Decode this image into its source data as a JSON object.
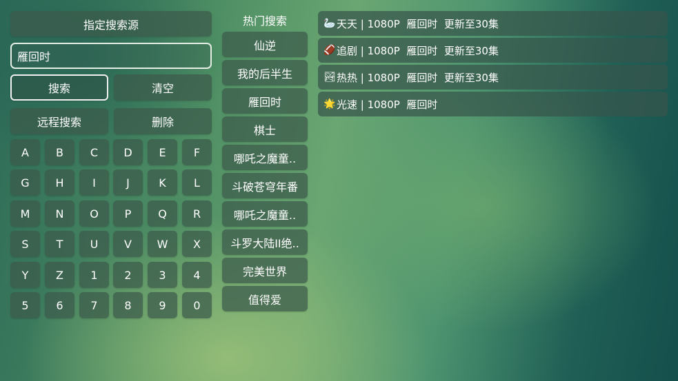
{
  "left_panel": {
    "source_button": "指定搜索源",
    "search_input": {
      "value": "雁回时",
      "placeholder": ""
    },
    "search_button": "搜索",
    "clear_button": "清空",
    "remote_search_button": "远程搜索",
    "delete_button": "删除",
    "keyboard": [
      "A",
      "B",
      "C",
      "D",
      "E",
      "F",
      "G",
      "H",
      "I",
      "J",
      "K",
      "L",
      "M",
      "N",
      "O",
      "P",
      "Q",
      "R",
      "S",
      "T",
      "U",
      "V",
      "W",
      "X",
      "Y",
      "Z",
      "1",
      "2",
      "3",
      "4",
      "5",
      "6",
      "7",
      "8",
      "9",
      "0"
    ]
  },
  "hot_search": {
    "title": "热门搜索",
    "items": [
      "仙逆",
      "我的后半生",
      "雁回时",
      "棋士",
      "哪吒之魔童..",
      "斗破苍穹年番",
      "哪吒之魔童..",
      "斗罗大陆II绝..",
      "完美世界",
      "值得爱"
    ]
  },
  "results": [
    {
      "icon": "🦢",
      "icon_name": "swan-icon",
      "text": "天天 | 1080P  雁回时  更新至30集"
    },
    {
      "icon": "🏈",
      "icon_name": "football-icon",
      "text": "追剧 | 1080P  雁回时  更新至30集"
    },
    {
      "icon": "🏞",
      "icon_name": "landscape-icon",
      "text": "热热 | 1080P  雁回时  更新至30集"
    },
    {
      "icon": "🌟",
      "icon_name": "star-icon",
      "text": "光速 | 1080P  雁回时"
    }
  ]
}
